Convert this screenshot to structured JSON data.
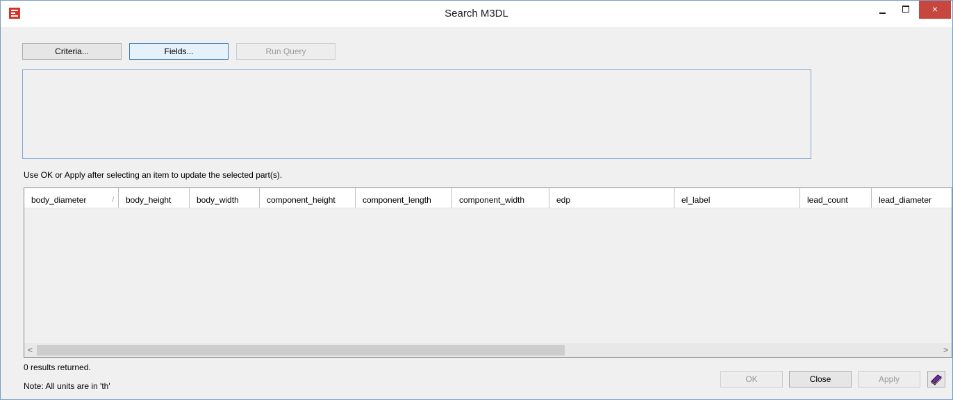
{
  "window": {
    "title": "Search M3DL",
    "app_icon": "app-logo-icon",
    "controls": {
      "minimize": "minimize-icon",
      "maximize": "maximize-icon",
      "close": "×"
    }
  },
  "toolbar": {
    "criteria_label": "Criteria...",
    "fields_label": "Fields...",
    "run_query_label": "Run Query"
  },
  "hint_text": "Use OK or Apply after selecting an item to update the selected part(s).",
  "grid": {
    "columns": [
      "body_diameter",
      "body_height",
      "body_width",
      "component_height",
      "component_length",
      "component_width",
      "edp",
      "el_label",
      "lead_count",
      "lead_diameter"
    ],
    "sort_indicator": "/",
    "rows": []
  },
  "scrollbar": {
    "left_arrow": "<",
    "right_arrow": ">"
  },
  "status": {
    "results": "0 results returned.",
    "note": "Note: All units are in 'th'"
  },
  "footer": {
    "ok_label": "OK",
    "close_label": "Close",
    "apply_label": "Apply",
    "help_icon": "help-book-icon"
  },
  "colors": {
    "close_button": "#c7463d",
    "focus_border": "#3c7fb1",
    "accent_icon": "#d9322b"
  }
}
